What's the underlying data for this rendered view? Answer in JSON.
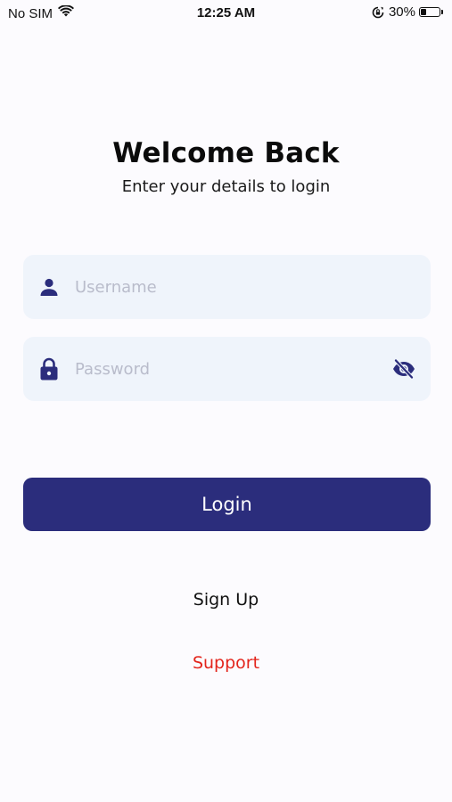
{
  "status_bar": {
    "carrier": "No SIM",
    "time": "12:25 AM",
    "battery_percent": "30%",
    "battery_level": 0.3,
    "icons": [
      "wifi-icon",
      "orientation-lock-icon",
      "battery-icon"
    ]
  },
  "header": {
    "title": "Welcome Back",
    "subtitle": "Enter your details to login"
  },
  "form": {
    "username": {
      "placeholder": "Username",
      "value": "",
      "icon": "user-icon"
    },
    "password": {
      "placeholder": "Password",
      "value": "",
      "icon": "lock-icon",
      "toggle_icon": "eye-off-icon"
    },
    "login_label": "Login"
  },
  "links": {
    "signup": "Sign Up",
    "support": "Support"
  },
  "colors": {
    "primary": "#2b2d7c",
    "field_background": "#eff4fb",
    "placeholder": "#b9bccb",
    "support": "#e3241b",
    "background": "#fcfbfe"
  }
}
